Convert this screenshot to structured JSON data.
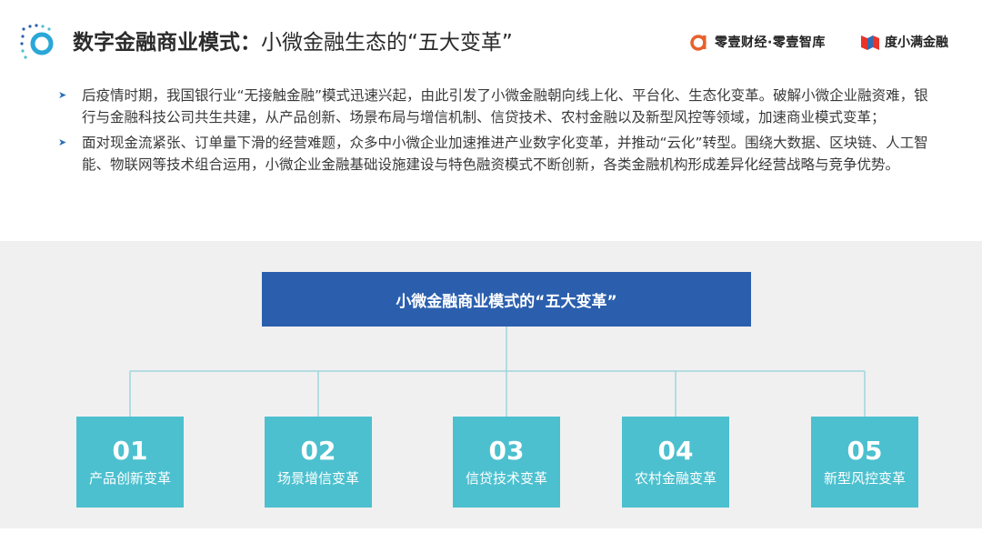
{
  "header": {
    "title_bold": "数字金融商业模式：",
    "title_light": "小微金融生态的“五大变革”",
    "brands": [
      {
        "icon": "lingyi-logo-icon",
        "text": "零壹财经·零壹智库",
        "color": "#e8612c"
      },
      {
        "icon": "duxiaoman-logo-icon",
        "text": "度小满金融",
        "color": "#e8352b"
      }
    ]
  },
  "bullets": [
    "后疫情时期，我国银行业“无接触金融”模式迅速兴起，由此引发了小微金融朝向线上化、平台化、生态化变革。破解小微企业融资难，银行与金融科技公司共生共建，从产品创新、场景布局与增信机制、信贷技术、农村金融以及新型风控等领域，加速商业模式变革；",
    "面对现金流紧张、订单量下滑的经营难题，众多中小微企业加速推进产业数字化变革，并推动“云化”转型。围绕大数据、区块链、人工智能、物联网等技术组合运用，小微企业金融基础设施建设与特色融资模式不断创新，各类金融机构形成差异化经营战略与竞争优势。"
  ],
  "diagram": {
    "root": "小微金融商业模式的“五大变革”",
    "children": [
      {
        "num": "01",
        "label": "产品创新变革"
      },
      {
        "num": "02",
        "label": "场景增信变革"
      },
      {
        "num": "03",
        "label": "信贷技术变革"
      },
      {
        "num": "04",
        "label": "农村金融变革"
      },
      {
        "num": "05",
        "label": "新型风控变革"
      }
    ]
  },
  "colors": {
    "root_box": "#2b5fae",
    "child_box": "#4cc0cf",
    "connector": "#9fd6de",
    "panel_bg": "#f0f0f0",
    "accent": "#2a6fb8"
  }
}
